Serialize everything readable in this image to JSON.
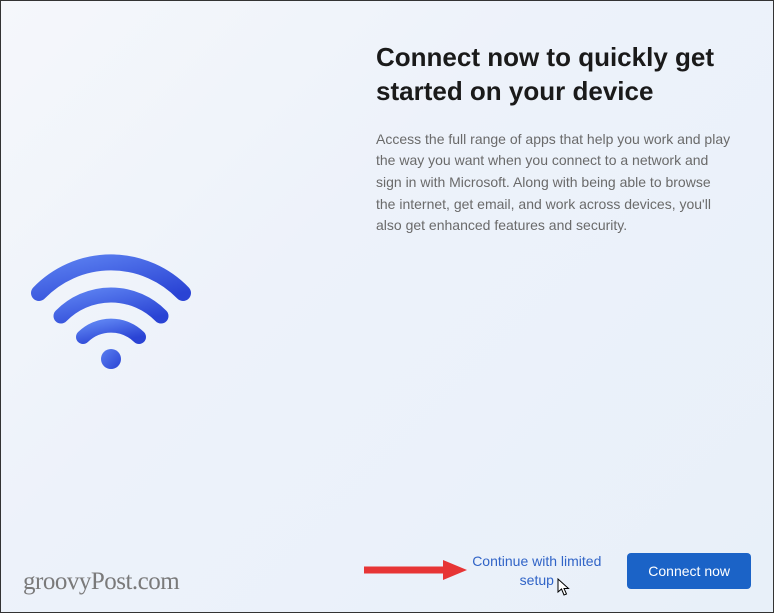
{
  "header": {
    "title": "Connect now to quickly get started on your device",
    "description": "Access the full range of apps that help you work and play the way you want when you connect to a network and sign in with Microsoft. Along with being able to browse the internet, get email, and work across devices, you'll also get enhanced features and security."
  },
  "actions": {
    "secondary_label": "Continue with limited setup",
    "primary_label": "Connect now"
  },
  "watermark": "groovyPost.com",
  "icons": {
    "wifi": "wifi-icon",
    "cursor": "cursor-pointer-icon"
  },
  "colors": {
    "accent": "#1b63c7",
    "link": "#3164c7",
    "text_primary": "#1a1a1a",
    "text_secondary": "#6a6a6a",
    "annotation_arrow": "#e73535"
  }
}
